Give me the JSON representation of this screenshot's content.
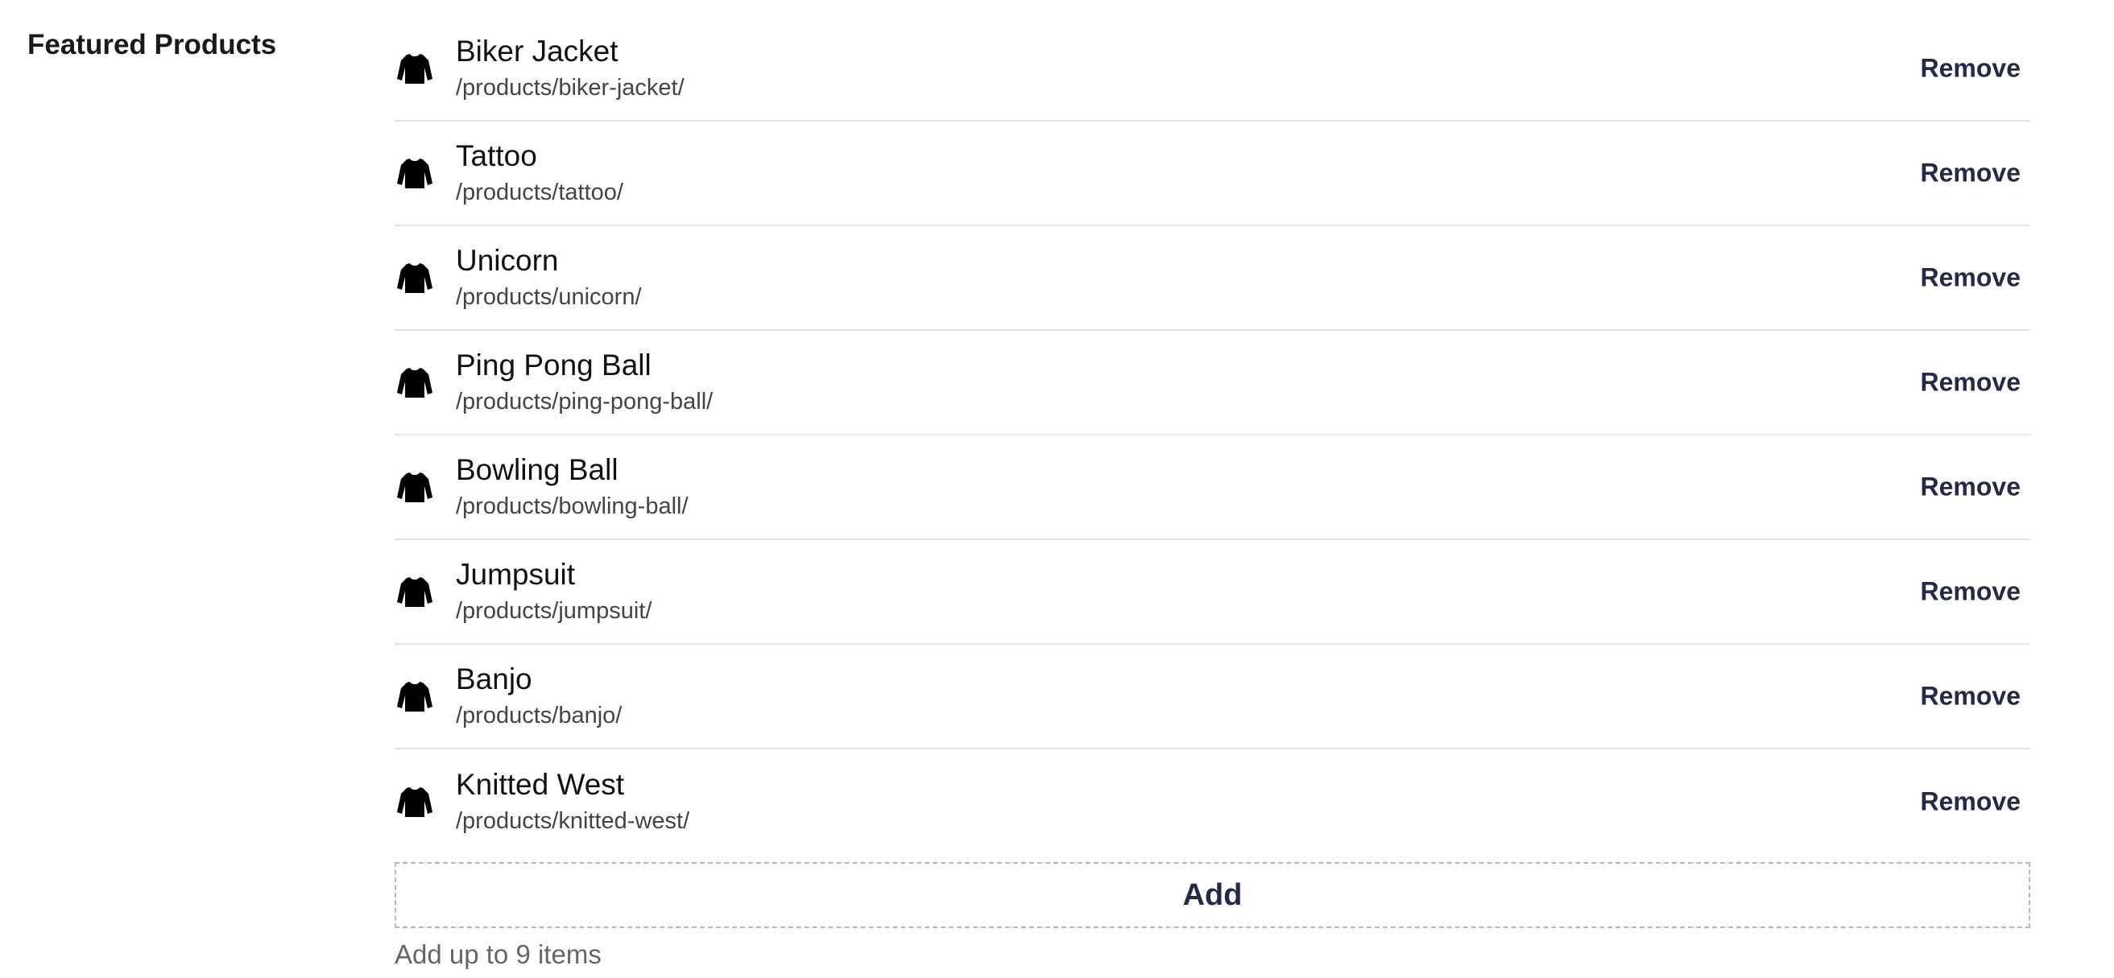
{
  "field": {
    "label": "Featured Products"
  },
  "products": [
    {
      "name": "Biker Jacket",
      "path": "/products/biker-jacket/",
      "icon": "sweater-icon",
      "remove_label": "Remove"
    },
    {
      "name": "Tattoo",
      "path": "/products/tattoo/",
      "icon": "sweater-icon",
      "remove_label": "Remove"
    },
    {
      "name": "Unicorn",
      "path": "/products/unicorn/",
      "icon": "sweater-icon",
      "remove_label": "Remove"
    },
    {
      "name": "Ping Pong Ball",
      "path": "/products/ping-pong-ball/",
      "icon": "sweater-icon",
      "remove_label": "Remove"
    },
    {
      "name": "Bowling Ball",
      "path": "/products/bowling-ball/",
      "icon": "sweater-icon",
      "remove_label": "Remove"
    },
    {
      "name": "Jumpsuit",
      "path": "/products/jumpsuit/",
      "icon": "sweater-icon",
      "remove_label": "Remove"
    },
    {
      "name": "Banjo",
      "path": "/products/banjo/",
      "icon": "sweater-icon",
      "remove_label": "Remove"
    },
    {
      "name": "Knitted West",
      "path": "/products/knitted-west/",
      "icon": "sweater-icon",
      "remove_label": "Remove"
    }
  ],
  "add_button": {
    "label": "Add"
  },
  "help_text": "Add up to 9 items",
  "colors": {
    "accent": "#262a48",
    "divider": "#e6e6e6",
    "dashed_border": "#b8b8b8",
    "secondary_text": "#444444",
    "help_text": "#666666"
  }
}
